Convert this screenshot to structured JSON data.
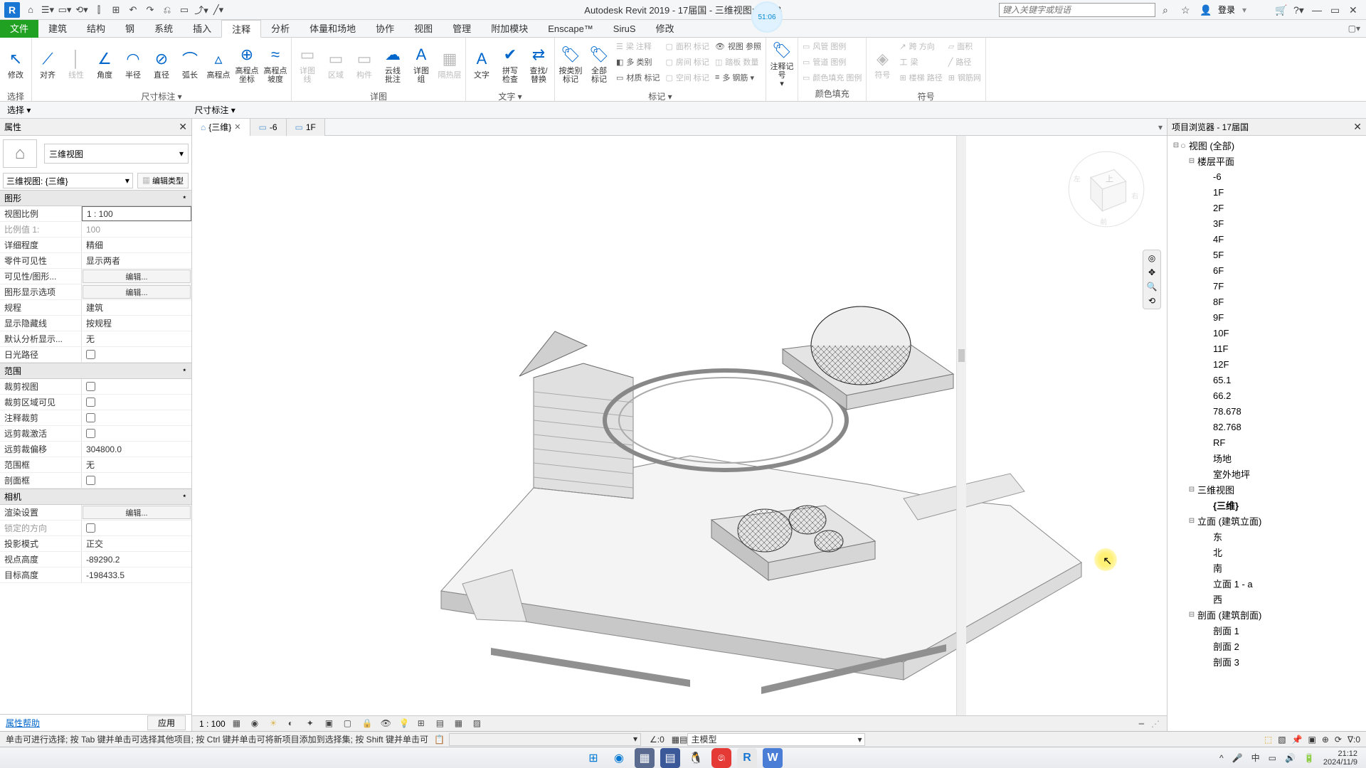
{
  "titlebar": {
    "app_title": "Autodesk Revit 2019 - 17届国 - 三维视图: {三维}",
    "timer": "51:06",
    "search_placeholder": "键入关键字或短语",
    "login": "登录"
  },
  "tabs": {
    "file": "文件",
    "list": [
      "建筑",
      "结构",
      "钢",
      "系统",
      "插入",
      "注释",
      "分析",
      "体量和场地",
      "协作",
      "视图",
      "管理",
      "附加模块",
      "Enscape™",
      "SiruS",
      "修改"
    ],
    "active": "注释"
  },
  "ribbon": {
    "groups": [
      {
        "label": "选择",
        "buttons": [
          {
            "icon": "↖",
            "label": "修改"
          }
        ]
      },
      {
        "label": "尺寸标注 ▾",
        "buttons": [
          {
            "icon": "⟋",
            "label": "对齐"
          },
          {
            "icon": "│",
            "label": "线性",
            "disabled": true
          },
          {
            "icon": "∠",
            "label": "角度"
          },
          {
            "icon": "◠",
            "label": "半径"
          },
          {
            "icon": "⊘",
            "label": "直径"
          },
          {
            "icon": "⌒",
            "label": "弧长"
          },
          {
            "icon": "▵",
            "label": "高程点"
          },
          {
            "icon": "⊕",
            "label": "高程点\n坐标"
          },
          {
            "icon": "≈",
            "label": "高程点\n坡度"
          }
        ]
      },
      {
        "label": "详图",
        "buttons": [
          {
            "icon": "▭",
            "label": "详图\n线",
            "disabled": true
          },
          {
            "icon": "▭",
            "label": "区域",
            "disabled": true
          },
          {
            "icon": "▭",
            "label": "构件",
            "disabled": true
          },
          {
            "icon": "☁",
            "label": "云线\n批注"
          },
          {
            "icon": "A",
            "label": "详图\n组"
          },
          {
            "icon": "▦",
            "label": "隔热层",
            "disabled": true
          }
        ]
      },
      {
        "label": "文字 ▾",
        "buttons": [
          {
            "icon": "A",
            "label": "文字"
          },
          {
            "icon": "✔",
            "label": "拼写\n检查"
          },
          {
            "icon": "⇄",
            "label": "查找/\n替换"
          }
        ]
      },
      {
        "label": "标记 ▾",
        "buttons": [
          {
            "icon": "🏷",
            "label": "按类别\n标记"
          },
          {
            "icon": "🏷",
            "label": "全部\n标记"
          }
        ],
        "stack": [
          {
            "icon": "☰",
            "label": "梁 注释",
            "disabled": true
          },
          {
            "icon": "◧",
            "label": "多 类别"
          },
          {
            "icon": "▭",
            "label": "材质 标记"
          }
        ],
        "stack2": [
          {
            "icon": "▢",
            "label": "面积 标记",
            "disabled": true
          },
          {
            "icon": "▢",
            "label": "房间 标记",
            "disabled": true
          },
          {
            "icon": "▢",
            "label": "空间 标记",
            "disabled": true
          }
        ],
        "stack3": [
          {
            "icon": "👁",
            "label": "视图 参照"
          },
          {
            "icon": "◫",
            "label": "踏板 数量",
            "disabled": true
          },
          {
            "icon": "≡",
            "label": "多 钢筋 ▾"
          }
        ]
      },
      {
        "label": "",
        "buttons": [
          {
            "icon": "🏷",
            "label": "注释记号\n▾"
          }
        ]
      },
      {
        "label": "颜色填充",
        "stack": [
          {
            "icon": "▭",
            "label": "风管 图例",
            "disabled": true
          },
          {
            "icon": "▭",
            "label": "管道 图例",
            "disabled": true
          },
          {
            "icon": "▭",
            "label": "颜色填充 图例",
            "disabled": true
          }
        ],
        "buttons": []
      },
      {
        "label": "符号",
        "buttons": [
          {
            "icon": "◈",
            "label": "符号",
            "disabled": true
          }
        ],
        "stack": [
          {
            "icon": "↗",
            "label": "跨 方向",
            "disabled": true
          },
          {
            "icon": "工",
            "label": "梁",
            "disabled": true
          },
          {
            "icon": "⊞",
            "label": "楼梯 路径",
            "disabled": true
          }
        ],
        "stack2": [
          {
            "icon": "▱",
            "label": "面积",
            "disabled": true
          },
          {
            "icon": "╱",
            "label": "路径",
            "disabled": true
          },
          {
            "icon": "⊞",
            "label": "钢筋网",
            "disabled": true
          }
        ]
      }
    ]
  },
  "options_bar": {
    "select": "选择 ▾",
    "dim": "尺寸标注 ▾"
  },
  "view_tabs": [
    {
      "icon": "⌂",
      "label": "{三维}",
      "active": true
    },
    {
      "icon": "▭",
      "label": "-6"
    },
    {
      "icon": "▭",
      "label": "1F"
    }
  ],
  "properties": {
    "title": "属性",
    "type_name": "三维视图",
    "instance_sel": "三维视图: {三维}",
    "edit_type": "编辑类型",
    "sections": [
      {
        "name": "图形",
        "rows": [
          {
            "label": "视图比例",
            "value": "1 : 100",
            "boxed": true
          },
          {
            "label": "比例值 1:",
            "value": "100",
            "dim": true
          },
          {
            "label": "详细程度",
            "value": "精细"
          },
          {
            "label": "零件可见性",
            "value": "显示两者"
          },
          {
            "label": "可见性/图形...",
            "value": "编辑...",
            "btn": true
          },
          {
            "label": "图形显示选项",
            "value": "编辑...",
            "btn": true
          },
          {
            "label": "规程",
            "value": "建筑"
          },
          {
            "label": "显示隐藏线",
            "value": "按规程"
          },
          {
            "label": "默认分析显示...",
            "value": "无"
          },
          {
            "label": "日光路径",
            "value": "",
            "check": false
          }
        ]
      },
      {
        "name": "范围",
        "rows": [
          {
            "label": "裁剪视图",
            "value": "",
            "check": false
          },
          {
            "label": "裁剪区域可见",
            "value": "",
            "check": false
          },
          {
            "label": "注释裁剪",
            "value": "",
            "check": false
          },
          {
            "label": "远剪裁激活",
            "value": "",
            "check": false
          },
          {
            "label": "远剪裁偏移",
            "value": "304800.0"
          },
          {
            "label": "范围框",
            "value": "无"
          },
          {
            "label": "剖面框",
            "value": "",
            "check": false
          }
        ]
      },
      {
        "name": "相机",
        "rows": [
          {
            "label": "渲染设置",
            "value": "编辑...",
            "btn": true
          },
          {
            "label": "锁定的方向",
            "value": "",
            "check": false,
            "dim": true
          },
          {
            "label": "投影模式",
            "value": "正交"
          },
          {
            "label": "视点高度",
            "value": "-89290.2"
          },
          {
            "label": "目标高度",
            "value": "-198433.5"
          }
        ]
      }
    ],
    "help": "属性帮助",
    "apply": "应用"
  },
  "view_controls": {
    "scale": "1 : 100"
  },
  "browser": {
    "title": "项目浏览器 - 17届国",
    "tree": [
      {
        "lvl": 0,
        "exp": "-",
        "label": "视图 (全部)",
        "icon": "○"
      },
      {
        "lvl": 1,
        "exp": "-",
        "label": "楼层平面"
      },
      {
        "lvl": 2,
        "label": "-6"
      },
      {
        "lvl": 2,
        "label": "1F"
      },
      {
        "lvl": 2,
        "label": "2F"
      },
      {
        "lvl": 2,
        "label": "3F"
      },
      {
        "lvl": 2,
        "label": "4F"
      },
      {
        "lvl": 2,
        "label": "5F"
      },
      {
        "lvl": 2,
        "label": "6F"
      },
      {
        "lvl": 2,
        "label": "7F"
      },
      {
        "lvl": 2,
        "label": "8F"
      },
      {
        "lvl": 2,
        "label": "9F"
      },
      {
        "lvl": 2,
        "label": "10F"
      },
      {
        "lvl": 2,
        "label": "11F"
      },
      {
        "lvl": 2,
        "label": "12F"
      },
      {
        "lvl": 2,
        "label": "65.1"
      },
      {
        "lvl": 2,
        "label": "66.2"
      },
      {
        "lvl": 2,
        "label": "78.678"
      },
      {
        "lvl": 2,
        "label": "82.768"
      },
      {
        "lvl": 2,
        "label": "RF"
      },
      {
        "lvl": 2,
        "label": "场地"
      },
      {
        "lvl": 2,
        "label": "室外地坪"
      },
      {
        "lvl": 1,
        "exp": "-",
        "label": "三维视图"
      },
      {
        "lvl": 2,
        "label": "{三维}",
        "bold": true
      },
      {
        "lvl": 1,
        "exp": "-",
        "label": "立面 (建筑立面)"
      },
      {
        "lvl": 2,
        "label": "东"
      },
      {
        "lvl": 2,
        "label": "北"
      },
      {
        "lvl": 2,
        "label": "南"
      },
      {
        "lvl": 2,
        "label": "立面 1 - a"
      },
      {
        "lvl": 2,
        "label": "西"
      },
      {
        "lvl": 1,
        "exp": "-",
        "label": "剖面 (建筑剖面)"
      },
      {
        "lvl": 2,
        "label": "剖面 1"
      },
      {
        "lvl": 2,
        "label": "剖面 2"
      },
      {
        "lvl": 2,
        "label": "剖面 3"
      }
    ]
  },
  "status": {
    "hint": "单击可进行选择; 按 Tab 键并单击可选择其他项目; 按 Ctrl 键并单击可将新项目添加到选择集; 按 Shift 键并单击可",
    "angle": ":0",
    "model": "主模型",
    "filter": "∇:0"
  },
  "taskbar": {
    "time": "21:12",
    "date": "2024/11/9",
    "ime": "中"
  }
}
